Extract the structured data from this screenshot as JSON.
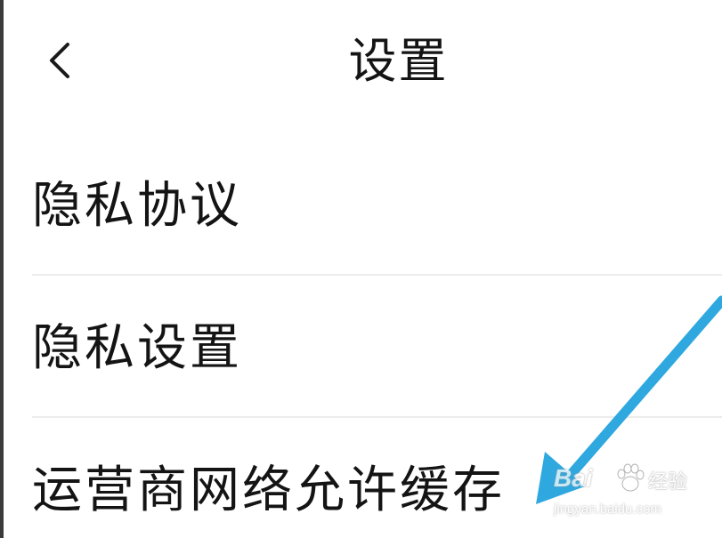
{
  "header": {
    "title": "设置",
    "back_icon": "chevron-left-icon"
  },
  "settings": {
    "items": [
      {
        "label": "隐私协议"
      },
      {
        "label": "隐私设置"
      },
      {
        "label": "运营商网络允许缓存"
      }
    ]
  },
  "annotation": {
    "arrow_color": "#2ea8df"
  },
  "watermark": {
    "brand": "Bai",
    "brand_suffix": "经验",
    "url": "jingyan.baidu.com"
  }
}
